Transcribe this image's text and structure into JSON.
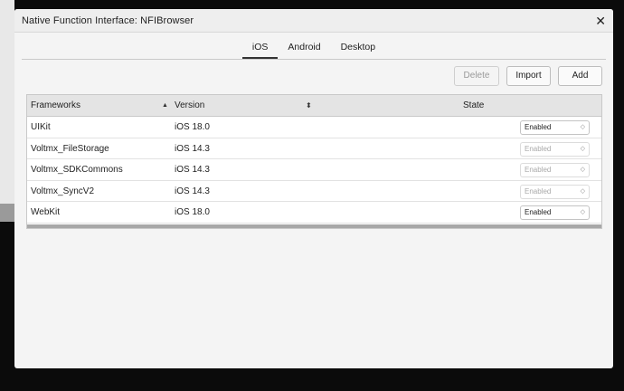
{
  "dialog": {
    "title": "Native Function Interface: NFIBrowser",
    "close_glyph": "✕"
  },
  "tabs": [
    {
      "label": "iOS",
      "active": true
    },
    {
      "label": "Android",
      "active": false
    },
    {
      "label": "Desktop",
      "active": false
    }
  ],
  "toolbar": {
    "delete_label": "Delete",
    "import_label": "Import",
    "add_label": "Add"
  },
  "table": {
    "headers": {
      "frameworks": "Frameworks",
      "version": "Version",
      "state": "State"
    },
    "rows": [
      {
        "framework": "UIKit",
        "version": "iOS 18.0",
        "state": "Enabled",
        "editable": true
      },
      {
        "framework": "Voltmx_FileStorage",
        "version": "iOS 14.3",
        "state": "Enabled",
        "editable": false
      },
      {
        "framework": "Voltmx_SDKCommons",
        "version": "iOS 14.3",
        "state": "Enabled",
        "editable": false
      },
      {
        "framework": "Voltmx_SyncV2",
        "version": "iOS 14.3",
        "state": "Enabled",
        "editable": false
      },
      {
        "framework": "WebKit",
        "version": "iOS 18.0",
        "state": "Enabled",
        "editable": true
      }
    ]
  }
}
